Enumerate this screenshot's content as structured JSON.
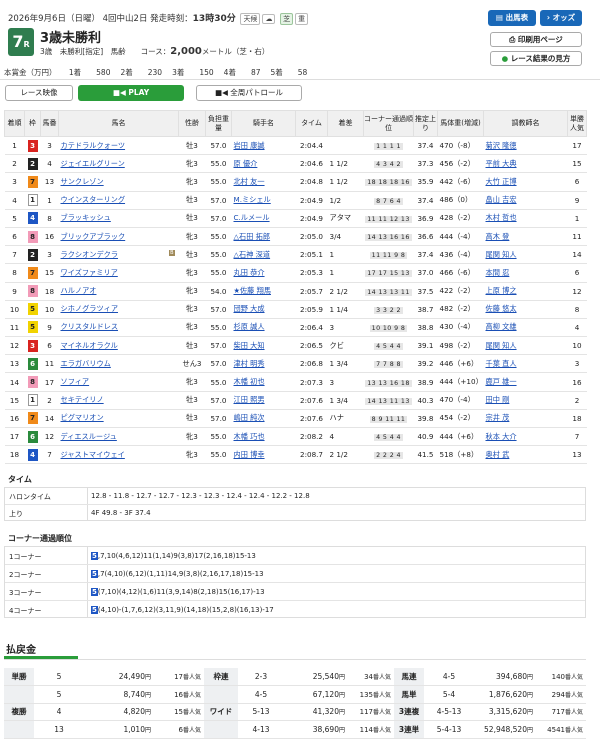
{
  "header": {
    "date_line": "2026年9月6日（日曜） 4回中山2日 発走時刻：",
    "start_time": "13時30分",
    "weather": "天候",
    "weather_icon": "cloud-icon",
    "surface": "芝",
    "going": "重",
    "race_no": "7",
    "race_no_suffix": "R",
    "race_title": "3歳未勝利",
    "race_cond_pre": "3歳　未勝利[指定]　馬齢　　コース：",
    "distance": "2,000",
    "race_cond_post": "メートル（芝・右）"
  },
  "buttons": {
    "horses": "出馬表",
    "odds": "オッズ",
    "print": "印刷用ページ",
    "result_view": "レース結果の見方",
    "race_video": "レース映像",
    "play": "PLAY",
    "patrol": "全周パトロール"
  },
  "prize": {
    "label": "本賞金（万円）",
    "items": [
      "1着　　580",
      "2着　　230",
      "3着　　150",
      "4着　　87",
      "5着　　58"
    ]
  },
  "colors": {
    "accent_blue": "#1968b8",
    "accent_green": "#2a9d3a",
    "race_green": "#2f7d4f"
  },
  "results_headers": [
    "着順",
    "枠",
    "馬番",
    "馬名",
    "性齢",
    "負担重量",
    "騎手名",
    "タイム",
    "着差",
    "コーナー通過順位",
    "推定上り",
    "馬体重(増減)",
    "調教師名",
    "単勝人気"
  ],
  "results": [
    {
      "pos": "1",
      "waku": "3",
      "num": "3",
      "horse": "カテドラルクォーツ",
      "sex_age": "牡3",
      "weight": "57.0",
      "jockey": "岩田 康誠",
      "time": "2:04.4",
      "margin": "",
      "corners": "1 1 1 1",
      "last3f": "37.4",
      "body_weight": "470（-8）",
      "trainer": "菊沢 隆徳",
      "pop": "17"
    },
    {
      "pos": "2",
      "waku": "2",
      "num": "4",
      "horse": "ジェイエルグリーン",
      "sex_age": "牝3",
      "weight": "55.0",
      "jockey": "原 優介",
      "time": "2:04.6",
      "margin": "1 1/2",
      "corners": "4 3 4 2",
      "last3f": "37.3",
      "body_weight": "456（-2）",
      "trainer": "平前 大典",
      "pop": "15"
    },
    {
      "pos": "3",
      "waku": "7",
      "num": "13",
      "horse": "サンクレゾン",
      "sex_age": "牝3",
      "weight": "55.0",
      "jockey": "北村 友一",
      "time": "2:04.8",
      "margin": "1 1/2",
      "corners": "18 18 18 16",
      "last3f": "35.9",
      "body_weight": "442（-6）",
      "trainer": "大竹 正博",
      "pop": "6"
    },
    {
      "pos": "4",
      "waku": "1",
      "num": "1",
      "horse": "ウインスターリング",
      "sex_age": "牡3",
      "weight": "57.0",
      "jockey": "M.ミシェル",
      "time": "2:04.9",
      "margin": "1/2",
      "corners": "8 7 6 4",
      "last3f": "37.4",
      "body_weight": "486（0）",
      "trainer": "畠山 吉宏",
      "pop": "9"
    },
    {
      "pos": "5",
      "waku": "4",
      "num": "8",
      "horse": "ブラッキッシュ",
      "sex_age": "牡3",
      "weight": "57.0",
      "jockey": "C.ルメール",
      "time": "2:04.9",
      "margin": "アタマ",
      "corners": "11 11 12 13",
      "last3f": "36.9",
      "body_weight": "428（-2）",
      "trainer": "木村 哲也",
      "pop": "1"
    },
    {
      "pos": "6",
      "waku": "8",
      "num": "16",
      "horse": "ブリックアブラック",
      "sex_age": "牝3",
      "weight": "55.0",
      "jockey": "△石田 拓郎",
      "time": "2:05.0",
      "margin": "3/4",
      "corners": "14 13 16 16",
      "last3f": "36.6",
      "body_weight": "444（-4）",
      "trainer": "高木 登",
      "pop": "11"
    },
    {
      "pos": "7",
      "waku": "2",
      "num": "3",
      "horse": "ラクシオンデクラ",
      "blinker": true,
      "sex_age": "牡3",
      "weight": "55.0",
      "jockey": "△石神 深道",
      "time": "2:05.1",
      "margin": "1",
      "corners": "11 11 9 8",
      "last3f": "37.4",
      "body_weight": "436（-4）",
      "trainer": "尾関 知人",
      "pop": "14"
    },
    {
      "pos": "8",
      "waku": "7",
      "num": "15",
      "horse": "ワイズファミリア",
      "sex_age": "牝3",
      "weight": "55.0",
      "jockey": "丸田 恭介",
      "time": "2:05.3",
      "margin": "1",
      "corners": "17 17 15 13",
      "last3f": "37.0",
      "body_weight": "466（-6）",
      "trainer": "本間 忍",
      "pop": "6"
    },
    {
      "pos": "9",
      "waku": "8",
      "num": "18",
      "horse": "ハルノアオ",
      "sex_age": "牝3",
      "weight": "54.0",
      "jockey": "★佐藤 翔馬",
      "time": "2:05.7",
      "margin": "2 1/2",
      "corners": "14 13 13 11",
      "last3f": "37.5",
      "body_weight": "422（-2）",
      "trainer": "上原 博之",
      "pop": "12"
    },
    {
      "pos": "10",
      "waku": "5",
      "num": "10",
      "horse": "シホノグラツィア",
      "sex_age": "牝3",
      "weight": "57.0",
      "jockey": "団野 大成",
      "time": "2:05.9",
      "margin": "1 1/4",
      "corners": "3 3 2 2",
      "last3f": "38.7",
      "body_weight": "482（-2）",
      "trainer": "佐藤 悠太",
      "pop": "8"
    },
    {
      "pos": "11",
      "waku": "5",
      "num": "9",
      "horse": "クリスタルドレス",
      "sex_age": "牝3",
      "weight": "55.0",
      "jockey": "杉原 誠人",
      "time": "2:06.4",
      "margin": "3",
      "corners": "10 10 9 8",
      "last3f": "38.8",
      "body_weight": "430（-4）",
      "trainer": "高柳 文雄",
      "pop": "4"
    },
    {
      "pos": "12",
      "waku": "3",
      "num": "6",
      "horse": "マイネルオラクル",
      "sex_age": "牡3",
      "weight": "57.0",
      "jockey": "柴田 大知",
      "time": "2:06.5",
      "margin": "クビ",
      "corners": "4 5 4 4",
      "last3f": "39.1",
      "body_weight": "498（-2）",
      "trainer": "尾関 知人",
      "pop": "10"
    },
    {
      "pos": "13",
      "waku": "6",
      "num": "11",
      "horse": "エラガバリウム",
      "sex_age": "せん3",
      "weight": "57.0",
      "jockey": "津村 明秀",
      "time": "2:06.8",
      "margin": "1 3/4",
      "corners": "7 7 8 8",
      "last3f": "39.2",
      "body_weight": "446（+6）",
      "trainer": "千葉 直人",
      "pop": "3"
    },
    {
      "pos": "14",
      "waku": "8",
      "num": "17",
      "horse": "ソフィア",
      "sex_age": "牝3",
      "weight": "55.0",
      "jockey": "木幡 初也",
      "time": "2:07.3",
      "margin": "3",
      "corners": "13 13 16 18",
      "last3f": "38.9",
      "body_weight": "444（+10）",
      "trainer": "鹿戸 雄一",
      "pop": "16"
    },
    {
      "pos": "15",
      "waku": "1",
      "num": "2",
      "horse": "セキテイリノ",
      "sex_age": "牡3",
      "weight": "57.0",
      "jockey": "江田 照男",
      "time": "2:07.6",
      "margin": "1 3/4",
      "corners": "14 13 11 13",
      "last3f": "40.3",
      "body_weight": "470（-4）",
      "trainer": "田中 剛",
      "pop": "2"
    },
    {
      "pos": "16",
      "waku": "7",
      "num": "14",
      "horse": "ピグマリオン",
      "sex_age": "牡3",
      "weight": "57.0",
      "jockey": "嶋田 純次",
      "time": "2:07.6",
      "margin": "ハナ",
      "corners": "8 9 11 11",
      "last3f": "39.8",
      "body_weight": "454（-2）",
      "trainer": "宗井 茂",
      "pop": "18"
    },
    {
      "pos": "17",
      "waku": "6",
      "num": "12",
      "horse": "ディエスルージュ",
      "sex_age": "牝3",
      "weight": "55.0",
      "jockey": "木幡 巧也",
      "time": "2:08.2",
      "margin": "4",
      "corners": "4 5 4 4",
      "last3f": "40.9",
      "body_weight": "444（+6）",
      "trainer": "秋本 大介",
      "pop": "7"
    },
    {
      "pos": "18",
      "waku": "4",
      "num": "7",
      "horse": "ジャストマイウェイ",
      "sex_age": "牝3",
      "weight": "55.0",
      "jockey": "内田 博幸",
      "time": "2:08.7",
      "margin": "2 1/2",
      "corners": "2 2 2 4",
      "last3f": "41.5",
      "body_weight": "518（+8）",
      "trainer": "奥村 武",
      "pop": "13"
    }
  ],
  "time_section": {
    "title": "タイム",
    "halon_label": "ハロンタイム",
    "halon": "12.8 - 11.8 - 12.7 - 12.7 - 12.3 - 12.3 - 12.4 - 12.4 - 12.2 - 12.8",
    "agari_label": "上り",
    "agari": "4F 49.8 - 3F 37.4"
  },
  "corner_section": {
    "title": "コーナー通過順位",
    "rows": [
      {
        "label": "1コーナー",
        "lead": "5",
        "rest": ",7,10(4,6,12)11(1,14)9(3,8)17(2,16,18)15-13"
      },
      {
        "label": "2コーナー",
        "lead": "5",
        "rest": ",7(4,10)(6,12)(1,11)14,9(3,8)(2,16,17,18)15-13"
      },
      {
        "label": "3コーナー",
        "lead": "5",
        "rest": "(7,10)(4,12)(1,6)11(3,9,14)8(2,18)15(16,17)-13"
      },
      {
        "label": "4コーナー",
        "lead": "5",
        "rest": "(4,10)-(1,7,6,12)(3,11,9)(14,18)(15,2,8)(16,13)-17"
      }
    ]
  },
  "payout": {
    "title": "払戻金",
    "yen": "円",
    "pop_suffix": "番人気",
    "rows": [
      {
        "c1": "単勝",
        "n1": "5",
        "a1": "24,490",
        "p1": "17",
        "c2": "枠連",
        "n2": "2-3",
        "a2": "25,540",
        "p2": "34",
        "c3": "馬連",
        "n3": "4-5",
        "a3": "394,680",
        "p3": "140"
      },
      {
        "c1": "",
        "n1": "5",
        "a1": "8,740",
        "p1": "16",
        "c2": "",
        "n2": "4-5",
        "a2": "67,120",
        "p2": "135",
        "c3": "馬単",
        "n3": "5-4",
        "a3": "1,876,620",
        "p3": "294"
      },
      {
        "c1": "複勝",
        "n1": "4",
        "a1": "4,820",
        "p1": "15",
        "c2": "ワイド",
        "n2": "5-13",
        "a2": "41,320",
        "p2": "117",
        "c3": "3連複",
        "n3": "4-5-13",
        "a3": "3,315,620",
        "p3": "717"
      },
      {
        "c1": "",
        "n1": "13",
        "a1": "1,010",
        "p1": "6",
        "c2": "",
        "n2": "4-13",
        "a2": "38,690",
        "p2": "114",
        "c3": "3連単",
        "n3": "5-4-13",
        "a3": "52,948,520",
        "p3": "4541"
      }
    ]
  }
}
